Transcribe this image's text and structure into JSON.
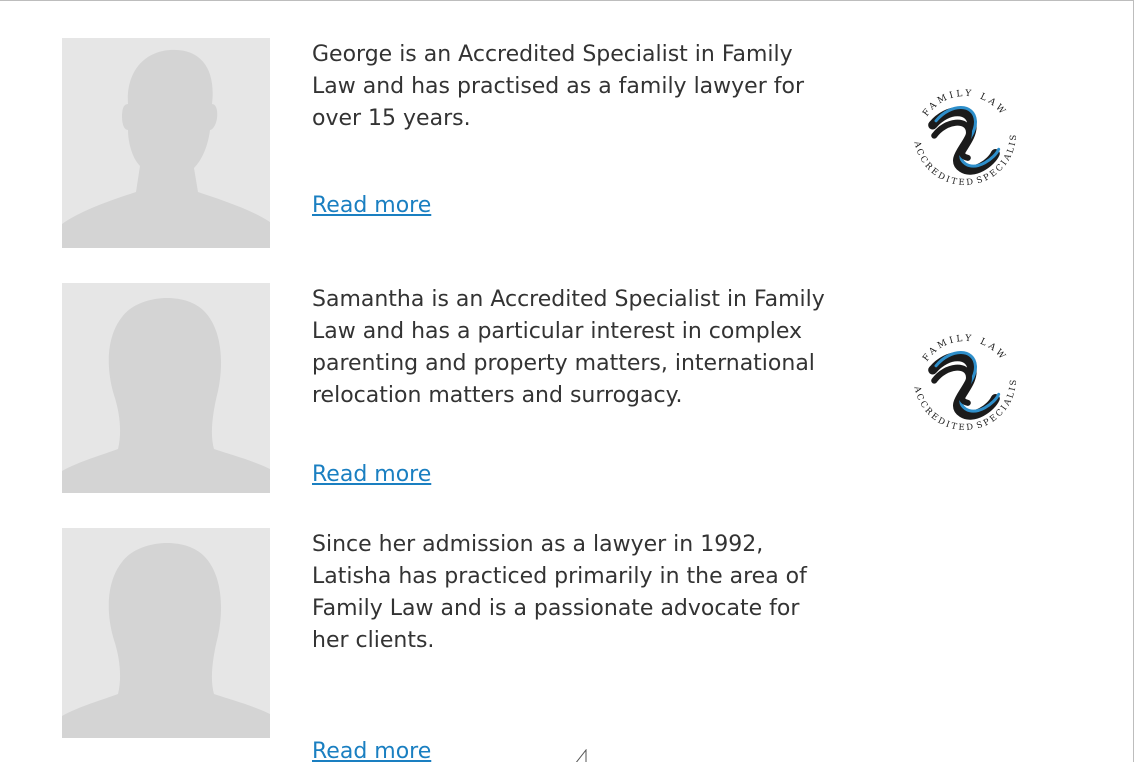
{
  "profiles": [
    {
      "bio": "George is an Accredited Specialist in Family Law and has practised as a family lawyer for over 15 years.",
      "link_label": "Read more",
      "silhouette": "male",
      "has_badge": true
    },
    {
      "bio": "Samantha is an Accredited Specialist in Family Law and has a particular interest in complex parenting and property matters, international relocation matters and surrogacy.",
      "link_label": "Read more",
      "silhouette": "female",
      "has_badge": true
    },
    {
      "bio": "Since her admission as a lawyer in 1992, Latisha has practiced primarily in the area of Family Law and is a passionate advocate for her clients.",
      "link_label": "Read more",
      "silhouette": "female",
      "has_badge": false
    }
  ],
  "badge": {
    "top_text": "FAMILY LAW",
    "left_text": "ACCREDITED",
    "bottom_text": "SPECIALIST"
  },
  "colors": {
    "link": "#1a7fc1",
    "text": "#333333",
    "photo_bg": "#e6e6e6",
    "silhouette": "#d4d4d4",
    "badge_blue": "#2e8fcb",
    "badge_dark": "#1b1b1b"
  },
  "icons": [
    "person-silhouette-icon",
    "accredited-specialist-seal-icon",
    "cursor-icon"
  ]
}
